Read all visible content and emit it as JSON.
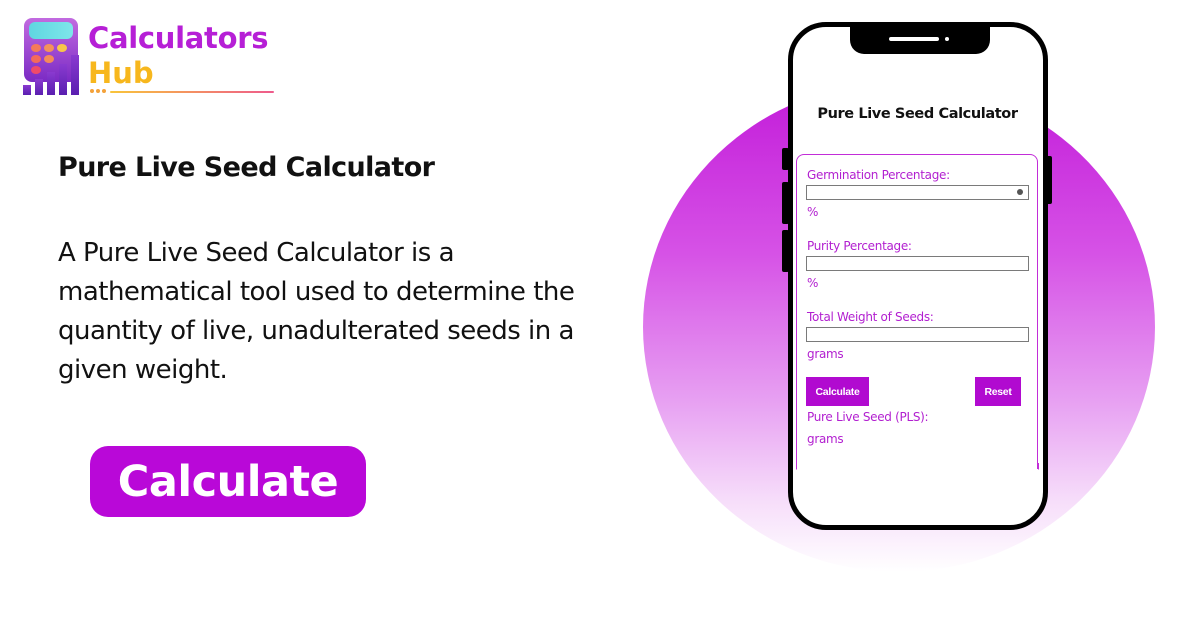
{
  "brand": {
    "name_line1": "Calculators",
    "name_line2": "Hub",
    "colors": {
      "primary": "#b61fd6",
      "secondary": "#f7b71d"
    }
  },
  "intro": {
    "heading": "Pure Live Seed Calculator",
    "description": "A Pure Live Seed Calculator is a mathematical tool used to determine the quantity of live, unadulterated seeds in a given weight.",
    "cta_label": "Calculate"
  },
  "phone": {
    "title": "Pure Live Seed Calculator",
    "fields": [
      {
        "label": "Germination Percentage:",
        "value": "",
        "unit": "%"
      },
      {
        "label": "Purity Percentage:",
        "value": "",
        "unit": "%"
      },
      {
        "label": "Total Weight of Seeds:",
        "value": "",
        "unit": "grams"
      }
    ],
    "calculate_label": "Calculate",
    "reset_label": "Reset",
    "result_label": "Pure Live Seed (PLS):",
    "result_unit": "grams"
  },
  "theme": {
    "accent": "#b908d8",
    "form_text": "#b21fd0"
  }
}
